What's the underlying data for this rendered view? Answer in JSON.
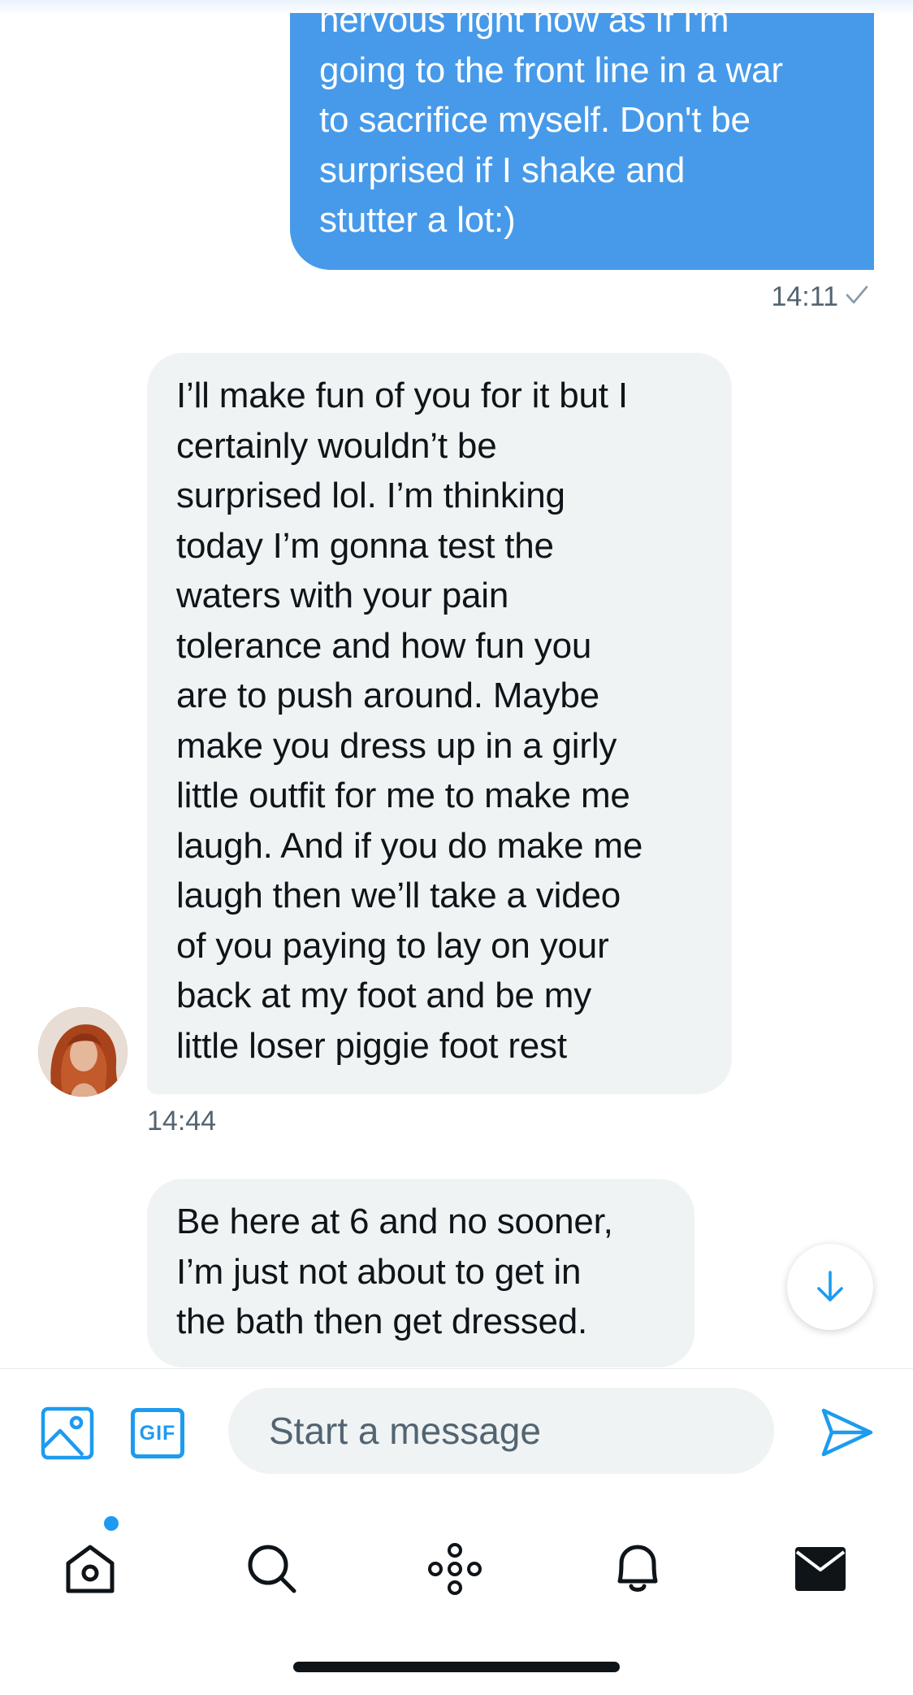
{
  "conversation": {
    "messages": [
      {
        "direction": "outgoing",
        "text": "nervous right now as if I'm\ngoing to the front line in a war\nto sacrifice myself. Don't be\nsurprised if I shake and\nstutter a lot:)",
        "time": "14:11",
        "status_icon": "checkmark-icon"
      },
      {
        "direction": "incoming",
        "text": "I’ll make fun of you for it but I\ncertainly wouldn’t be\nsurprised lol. I’m thinking\ntoday I’m gonna test the\nwaters with your pain\ntolerance and how fun you\nare to push around. Maybe\nmake you dress up in a girly\nlittle outfit for me to make me\nlaugh. And if you do make me\nlaugh then we’ll take a video\nof you paying to lay on your\nback at my foot and be my\nlittle loser piggie foot rest",
        "time": "14:44",
        "avatar_icon": "red-haired-profile-avatar"
      },
      {
        "direction": "incoming",
        "text": "Be here at 6 and no sooner,\nI’m just not about to get in\nthe bath then get dressed."
      }
    ],
    "scroll_button_icon": "arrow-down-icon"
  },
  "composer": {
    "media_icon": "image-icon",
    "gif_label": "GIF",
    "input_placeholder": "Start a message",
    "input_value": "",
    "send_icon": "send-icon"
  },
  "tabbar": {
    "items": [
      {
        "name": "home",
        "icon": "home-icon",
        "has_unread_dot": true
      },
      {
        "name": "search",
        "icon": "search-icon"
      },
      {
        "name": "spaces",
        "icon": "spaces-icon"
      },
      {
        "name": "notifications",
        "icon": "bell-icon"
      },
      {
        "name": "messages",
        "icon": "envelope-icon",
        "active": true
      }
    ]
  },
  "colors": {
    "accent": "#1d9bf0",
    "outgoing_bubble": "#479ae9",
    "incoming_bubble": "#eff3f4",
    "secondary_text": "#536471"
  }
}
